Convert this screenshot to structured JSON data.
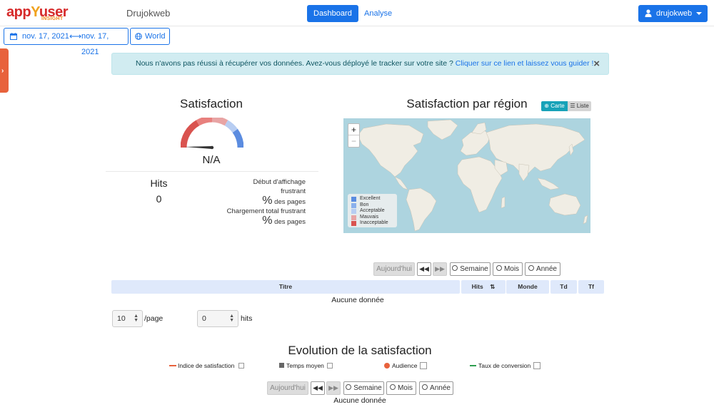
{
  "header": {
    "logo_text_main": "app",
    "logo_text_y": "Y",
    "logo_text_tail": "user",
    "logo_sub": "INSIGHT",
    "site_name": "Drujokweb",
    "nav": {
      "dashboard": "Dashboard",
      "analyse": "Analyse"
    },
    "user": {
      "name": "drujokweb",
      "icon": "user-icon"
    },
    "colors": {
      "primary": "#1a73e8",
      "logo": "#d62b2b"
    }
  },
  "filters": {
    "date_from": "nov. 17, 2021",
    "date_to": "nov. 17, 2021",
    "region": "World"
  },
  "alert": {
    "message": "Nous n'avons pas réussi à récupérer vos données. Avez-vous déployé le tracker sur votre site ? ",
    "link": "Cliquer sur ce lien et laissez vous guider !",
    "close": "×"
  },
  "satisfaction": {
    "title": "Satisfaction",
    "value": "N/A",
    "hits_label": "Hits",
    "hits_value": "0",
    "metric1_label_line1": "Début d'affichage",
    "metric1_label_line2": "frustrant",
    "metric1_pct": "%",
    "metric1_suffix": "des pages",
    "metric2_label": "Chargement total frustrant",
    "metric2_pct": "%",
    "metric2_suffix": "des pages"
  },
  "region": {
    "title": "Satisfaction par région",
    "toggle_map": "Carte",
    "toggle_list": "Liste",
    "zoom_in": "+",
    "zoom_out": "−",
    "legend": [
      {
        "label": "Excellent",
        "color": "#5b8ce0"
      },
      {
        "label": "Bon",
        "color": "#8ab0ec"
      },
      {
        "label": "Acceptable",
        "color": "#b7cdf2"
      },
      {
        "label": "Mauvais",
        "color": "#e8a4a4"
      },
      {
        "label": "Inacceptable",
        "color": "#d9534f"
      }
    ]
  },
  "period_toolbar": {
    "today": "Aujourd'hui",
    "week": "Semaine",
    "month": "Mois",
    "year": "Année"
  },
  "pages_table": {
    "columns": [
      "Titre",
      "Hits",
      "Monde",
      "Td",
      "Tf"
    ],
    "empty": "Aucune donnée",
    "per_page_value": "10",
    "per_page_label": "/page",
    "hits_filter_value": "0",
    "hits_filter_label": "hits"
  },
  "evolution": {
    "title": "Evolution de la satisfaction",
    "series": [
      {
        "label": "Indice de satisfaction",
        "color": "#e8623c"
      },
      {
        "label": "Temps moyen",
        "color": "#666666"
      },
      {
        "label": "Audience",
        "color": "#e8623c"
      },
      {
        "label": "Taux de conversion",
        "color": "#2e9e4f"
      }
    ],
    "empty": "Aucune donnée"
  }
}
